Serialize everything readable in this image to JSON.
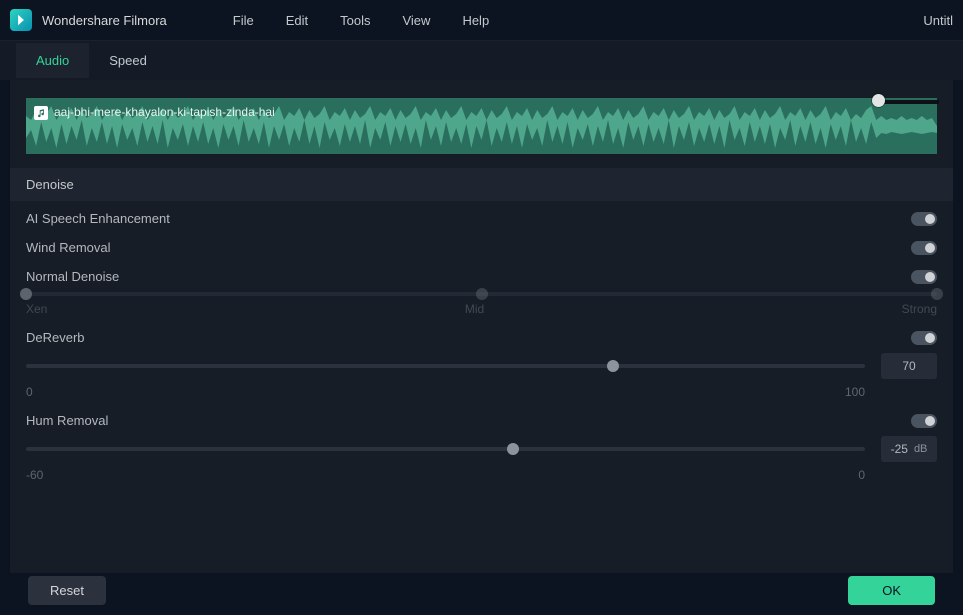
{
  "app": {
    "name": "Wondershare Filmora"
  },
  "menu": {
    "file": "File",
    "edit": "Edit",
    "tools": "Tools",
    "view": "View",
    "help": "Help"
  },
  "doc_title": "Untitl",
  "tabs": {
    "audio": "Audio",
    "speed": "Speed"
  },
  "clip": {
    "name": "aaj-bhi-mere-khayalon-ki-tapish-zinda-hai"
  },
  "section": {
    "denoise": "Denoise"
  },
  "controls": {
    "ai_speech": {
      "label": "AI Speech Enhancement",
      "on": true
    },
    "wind": {
      "label": "Wind Removal",
      "on": true
    },
    "normal": {
      "label": "Normal Denoise",
      "on": true,
      "min": "Xen",
      "mid": "Mid",
      "max": "Strong",
      "value_percent": 0
    },
    "dereverb": {
      "label": "DeReverb",
      "on": true,
      "min": "0",
      "max": "100",
      "value": "70",
      "value_percent": 70
    },
    "hum": {
      "label": "Hum Removal",
      "on": true,
      "min": "-60",
      "max": "0",
      "value": "-25",
      "unit": "dB",
      "value_percent": 58
    }
  },
  "footer": {
    "reset": "Reset",
    "ok": "OK"
  }
}
